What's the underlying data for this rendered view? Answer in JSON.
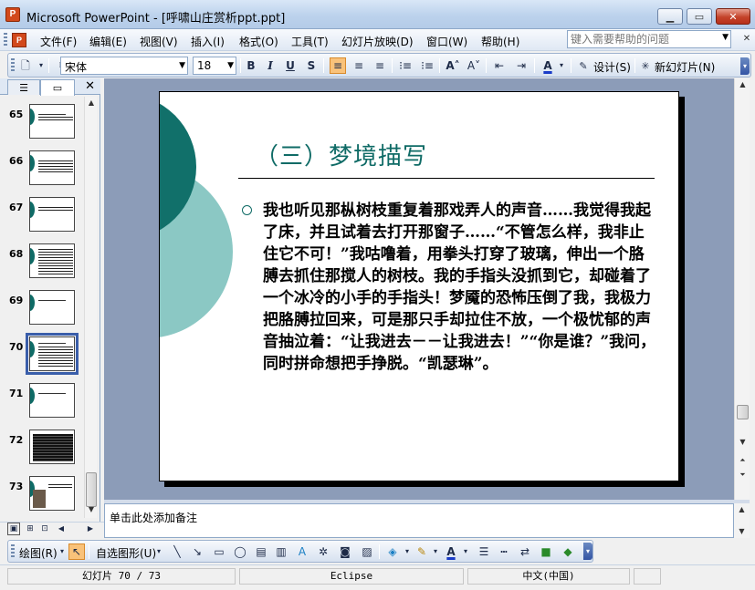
{
  "window": {
    "app_icon": "powerpoint-icon",
    "title": "Microsoft PowerPoint - [呼啸山庄赏析ppt.ppt]",
    "buttons": [
      "minimize-icon",
      "restore-icon",
      "close-icon"
    ]
  },
  "menu": {
    "items": [
      "文件(F)",
      "编辑(E)",
      "视图(V)",
      "插入(I)",
      "格式(O)",
      "工具(T)",
      "幻灯片放映(D)",
      "窗口(W)",
      "帮助(H)"
    ],
    "help_placeholder": "键入需要帮助的问题"
  },
  "format_toolbar": {
    "font_name": "宋体",
    "font_size": "18",
    "bold": "B",
    "italic": "I",
    "underline": "U",
    "shadow": "S",
    "design_label": "设计(S)",
    "new_slide_label": "新幻灯片(N)"
  },
  "slides_pane": {
    "thumbnails": [
      {
        "num": "65"
      },
      {
        "num": "66"
      },
      {
        "num": "67"
      },
      {
        "num": "68"
      },
      {
        "num": "69"
      },
      {
        "num": "70",
        "selected": true
      },
      {
        "num": "71"
      },
      {
        "num": "72"
      },
      {
        "num": "73"
      }
    ]
  },
  "slide": {
    "title": "（三）梦境描写",
    "body": "我也听见那枞树枝重复着那戏弄人的声音……我觉得我起了床，并且试着去打开那窗子……“不管怎么样，我非止住它不可！”我咕噜着，用拳头打穿了玻璃，伸出一个胳膊去抓住那搅人的树枝。我的手指头没抓到它，却碰着了一个冰冷的小手的手指头！梦魇的恐怖压倒了我，我极力把胳膊拉回来，可是那只手却拉住不放，一个极忧郁的声音抽泣着：“让我进去－－让我进去！”“你是谁？”我问，同时拼命想把手挣脱。“凯瑟琳”。",
    "accent_color": "#0f6b66"
  },
  "notes": {
    "placeholder": "单击此处添加备注"
  },
  "draw_toolbar": {
    "draw_label": "绘图(R)",
    "autoshapes_label": "自选图形(U)"
  },
  "status": {
    "slide_info": "幻灯片 70 / 73",
    "design": "Eclipse",
    "language": "中文(中国)"
  }
}
